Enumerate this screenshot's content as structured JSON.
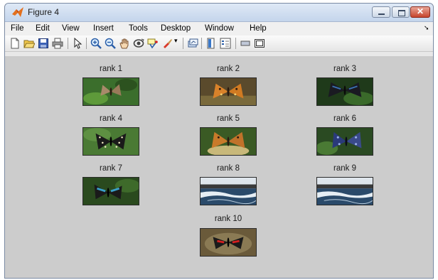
{
  "window": {
    "title": "Figure 4",
    "controls": [
      "minimize",
      "maximize",
      "close"
    ]
  },
  "menubar": {
    "items": [
      "File",
      "Edit",
      "View",
      "Insert",
      "Tools",
      "Desktop",
      "Window",
      "Help"
    ]
  },
  "toolbar": {
    "icons": [
      "new-figure-icon",
      "open-file-icon",
      "save-icon",
      "print-icon",
      "select-arrow-icon",
      "zoom-in-icon",
      "zoom-out-icon",
      "pan-hand-icon",
      "rotate-3d-icon",
      "data-cursor-icon",
      "brush-icon",
      "link-plot-icon",
      "colorbar-icon",
      "legend-icon",
      "hide-plot-tools-icon",
      "show-plot-tools-icon"
    ]
  },
  "results": [
    {
      "label": "rank 1",
      "image": "butterfly-on-leaves-image"
    },
    {
      "label": "rank 2",
      "image": "orange-butterfly-image"
    },
    {
      "label": "rank 3",
      "image": "dark-butterfly-image"
    },
    {
      "label": "rank 4",
      "image": "black-spotted-butterfly-image"
    },
    {
      "label": "rank 5",
      "image": "orange-butterfly-on-flower-image"
    },
    {
      "label": "rank 6",
      "image": "blue-butterfly-image"
    },
    {
      "label": "rank 7",
      "image": "blue-black-butterfly-image"
    },
    {
      "label": "rank 8",
      "image": "waterfall-image"
    },
    {
      "label": "rank 9",
      "image": "waterfall-image"
    },
    {
      "label": "rank 10",
      "image": "red-black-butterfly-image"
    }
  ],
  "colors": {
    "canvas": "#cccccc",
    "titlebar": "#c4d5ec",
    "close_button": "#c6432c"
  }
}
